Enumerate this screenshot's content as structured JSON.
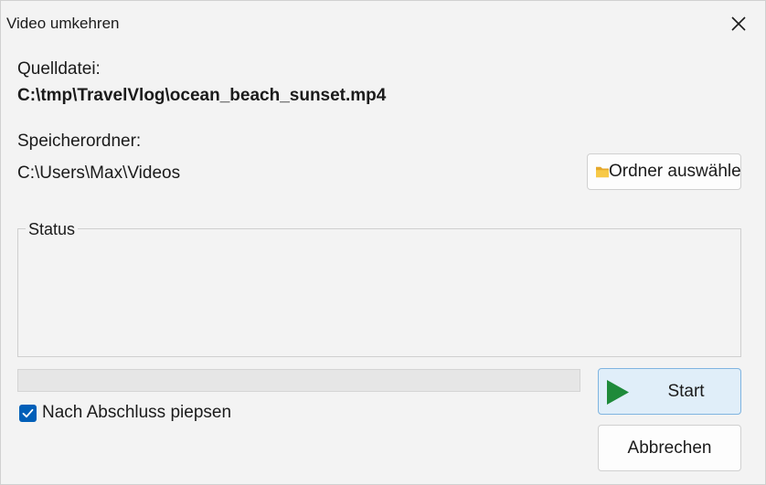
{
  "window": {
    "title": "Video umkehren",
    "close_icon": "close-icon"
  },
  "source": {
    "label": "Quelldatei:",
    "path": "C:\\tmp\\TravelVlog\\ocean_beach_sunset.mp4"
  },
  "output": {
    "label": "Speicherordner:",
    "path": "C:\\Users\\Max\\Videos",
    "choose_button_label": "Ordner auswähle",
    "choose_button_icon": "folder-icon"
  },
  "status": {
    "legend": "Status",
    "text": ""
  },
  "progress": {
    "fraction": 0
  },
  "beep": {
    "label": "Nach Abschluss piepsen",
    "checked": true
  },
  "actions": {
    "start_label": "Start",
    "start_icon": "play-icon",
    "cancel_label": "Abbrechen"
  },
  "colors": {
    "accent": "#005fb8",
    "play": "#1e8a3a",
    "folder": "#f5c342",
    "start_bg": "#e0eef9",
    "start_border": "#7fb4e0"
  }
}
